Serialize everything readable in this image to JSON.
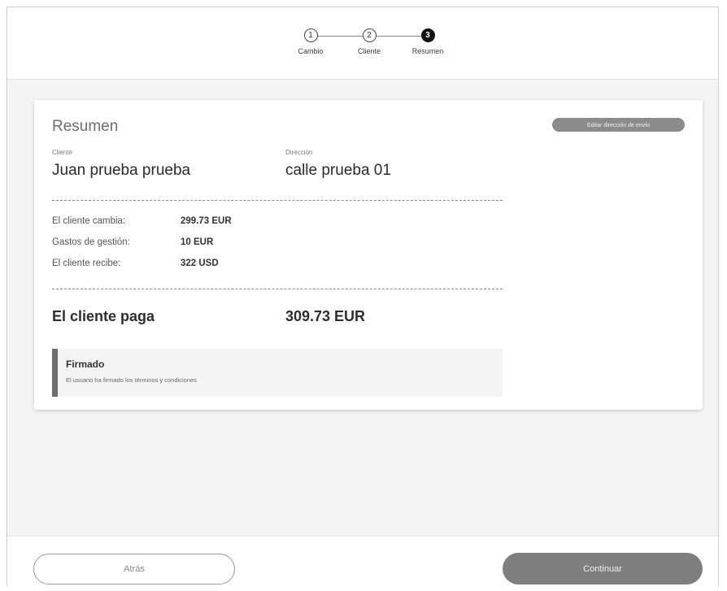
{
  "stepper": {
    "steps": [
      {
        "number": "1",
        "label": "Cambio"
      },
      {
        "number": "2",
        "label": "Cliente"
      },
      {
        "number": "3",
        "label": "Resumen"
      }
    ]
  },
  "card": {
    "title": "Resumen",
    "edit_button": "Editar dirección de envío",
    "client_label": "Cliente",
    "client_name": "Juan prueba prueba",
    "address_label": "Dirección",
    "address_value": "calle prueba 01",
    "rows": [
      {
        "label": "El cliente cambia:",
        "value": "299.73 EUR"
      },
      {
        "label": "Gastos de gestión:",
        "value": "10 EUR"
      },
      {
        "label": "El cliente recibe:",
        "value": "322 USD"
      }
    ],
    "total_label": "El cliente paga",
    "total_value": "309.73 EUR",
    "signed": {
      "title": "Firmado",
      "text": "El usuario ha firmado los términos y condiciones"
    }
  },
  "footer": {
    "back_label": "Atrás",
    "continue_label": "Continuar"
  },
  "colors": {
    "active_step": "#111111",
    "primary_button": "#7f7f7f",
    "edit_button": "#8b8b8b"
  }
}
